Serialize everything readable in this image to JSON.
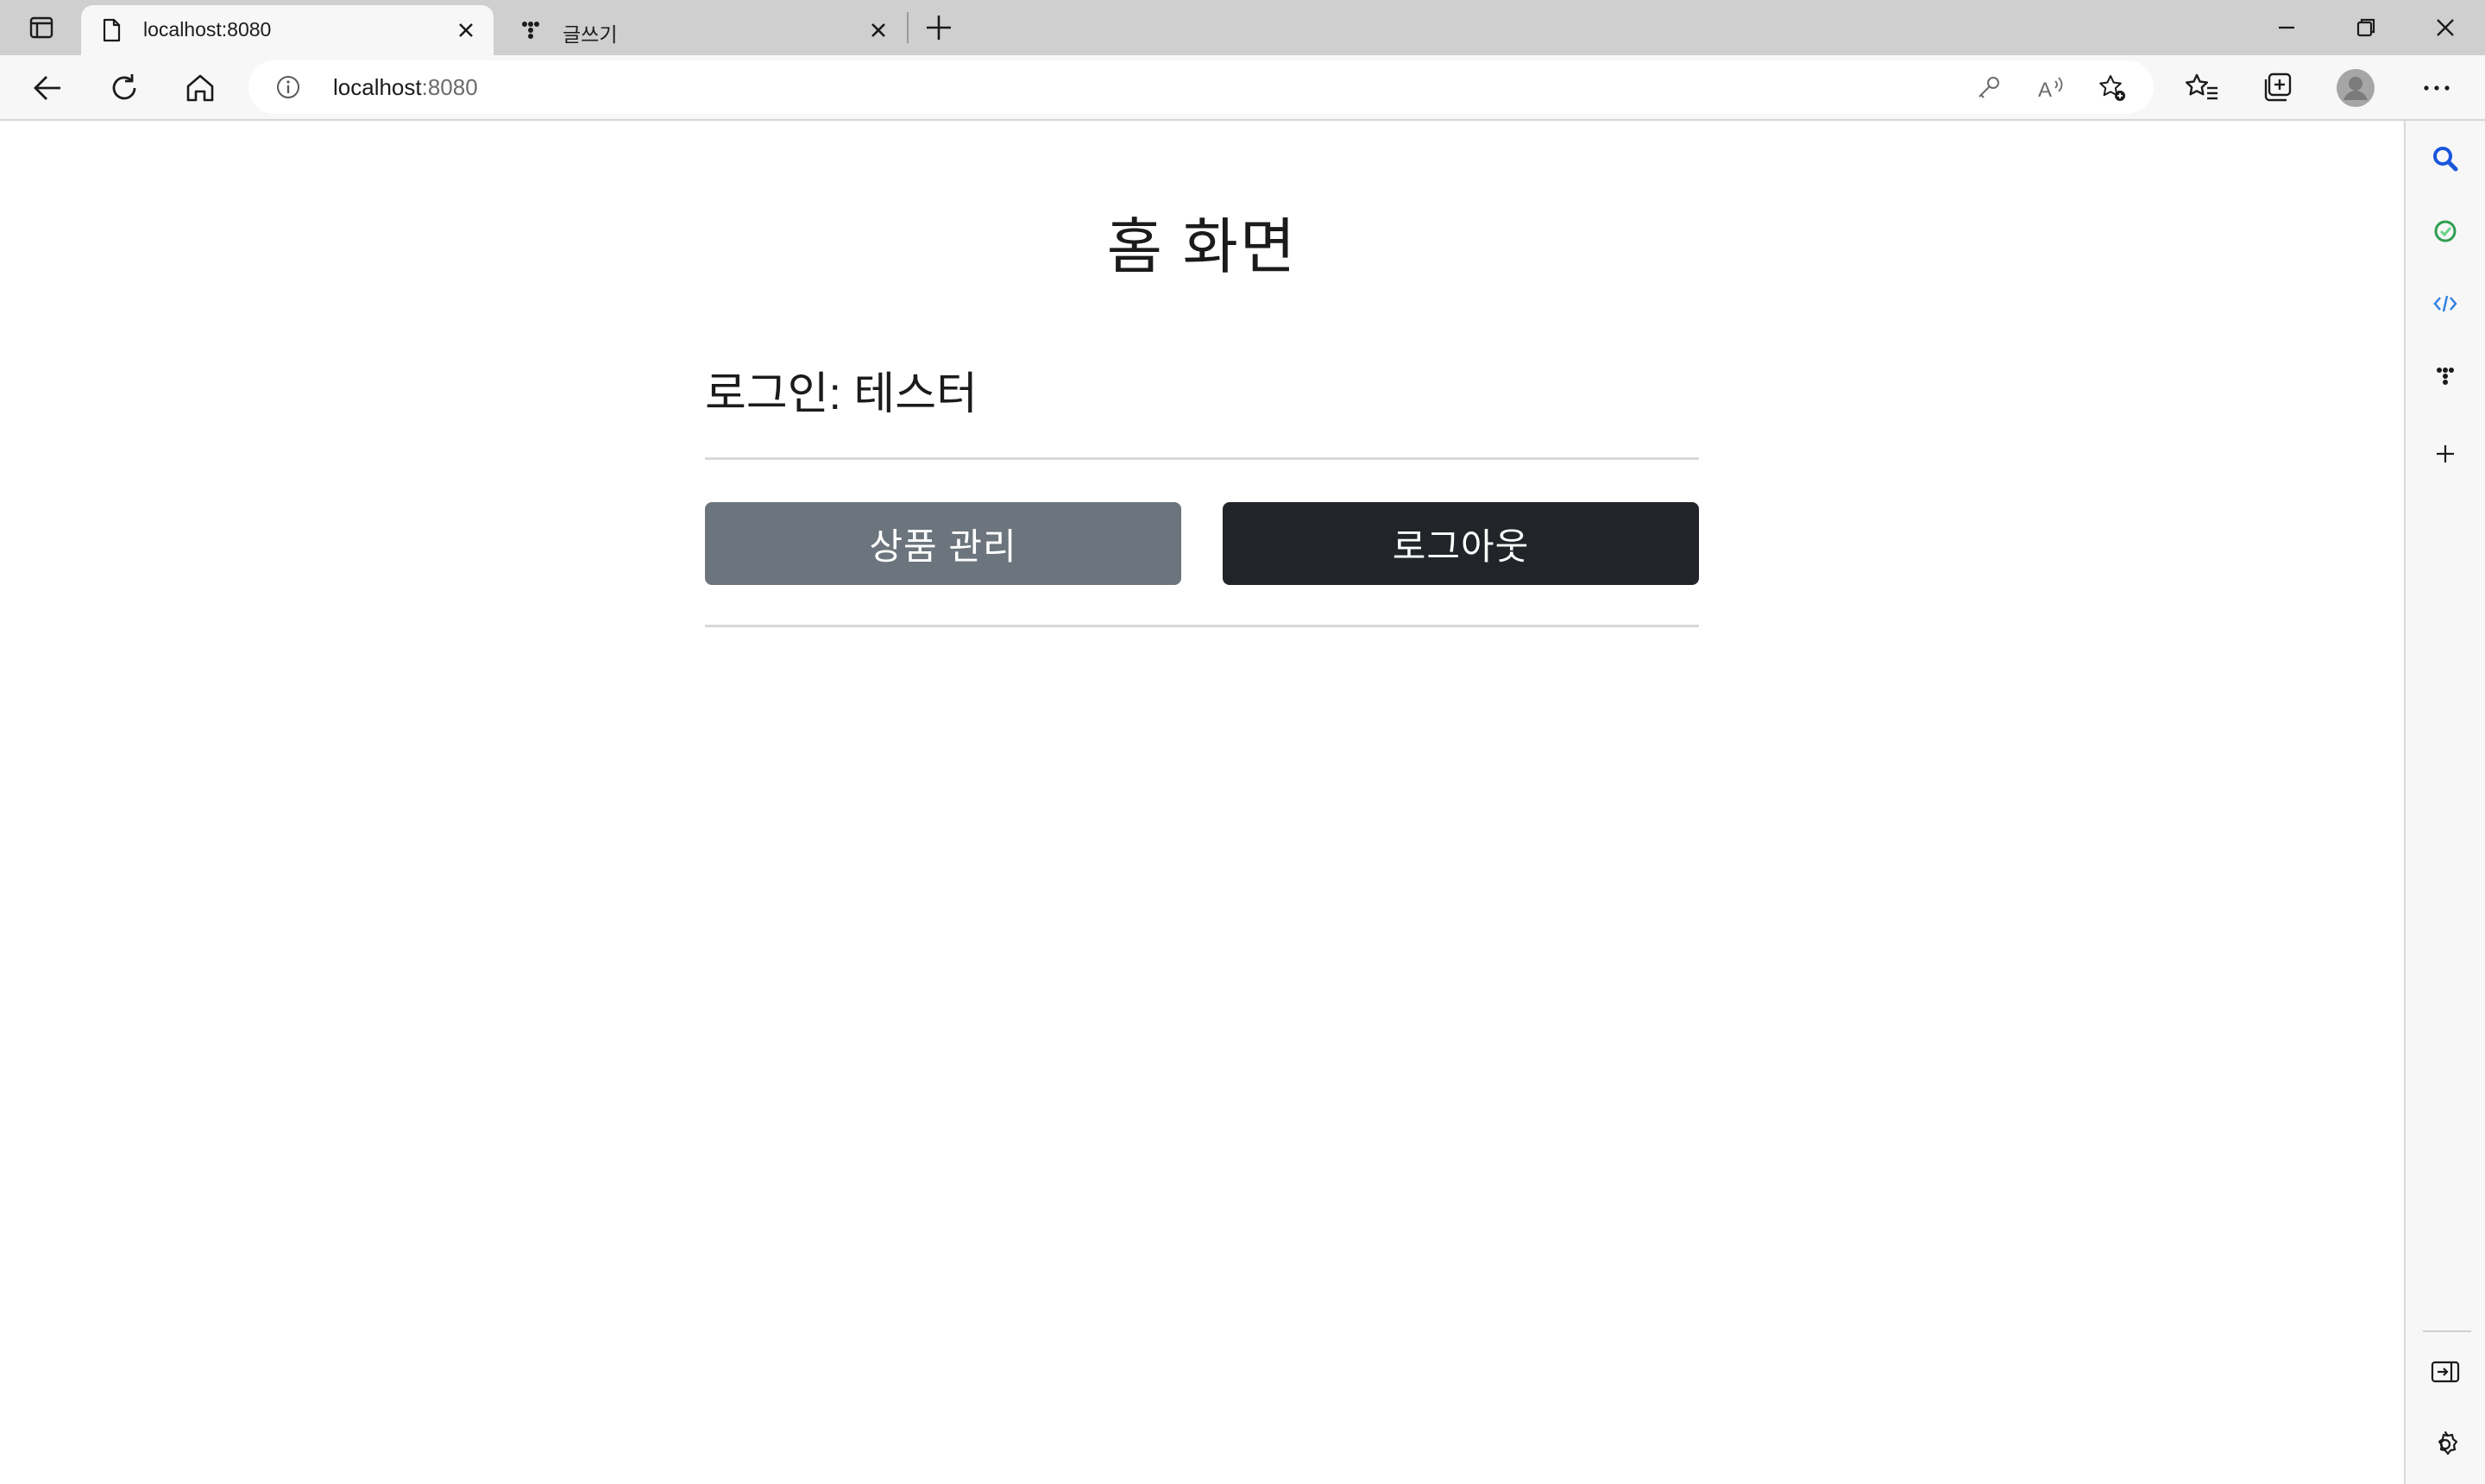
{
  "browser": {
    "tabs": [
      {
        "title": "localhost:8080",
        "active": true,
        "favicon": "page-icon"
      },
      {
        "title": "글쓰기",
        "active": false,
        "favicon": "dots-icon"
      }
    ],
    "address": {
      "host": "localhost",
      "port": ":8080"
    }
  },
  "page": {
    "title": "홈 화면",
    "login_text": "로그인: 테스터",
    "buttons": {
      "product_manage": "상품 관리",
      "logout": "로그아웃"
    }
  },
  "colors": {
    "secondary_button": "#6c757d",
    "dark_button": "#212529",
    "search_icon": "#1a56db",
    "copilot_icon": "#2e9e4f",
    "code_icon": "#2f7de1"
  }
}
